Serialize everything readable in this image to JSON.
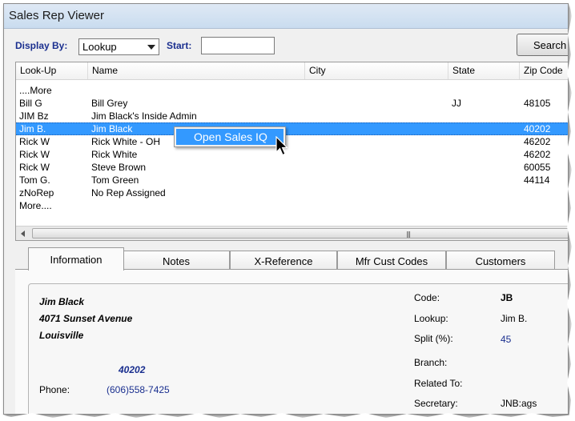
{
  "window": {
    "title": "Sales Rep Viewer"
  },
  "toolbar": {
    "display_by_label": "Display By:",
    "display_by_value": "Lookup",
    "start_label": "Start:",
    "start_value": "",
    "search_label": "Search"
  },
  "grid": {
    "columns": [
      "Look-Up",
      "Name",
      "City",
      "State",
      "Zip Code"
    ],
    "rows": [
      {
        "lookup": "....More",
        "name": "",
        "city": "",
        "state": "",
        "zip": ""
      },
      {
        "lookup": "Bill G",
        "name": "Bill Grey",
        "city": "",
        "state": "JJ",
        "zip": "48105"
      },
      {
        "lookup": "JIM Bz",
        "name": "Jim Black's Inside Admin",
        "city": "",
        "state": "",
        "zip": ""
      },
      {
        "lookup": "Jim B.",
        "name": "Jim Black",
        "city": "",
        "state": "",
        "zip": "40202"
      },
      {
        "lookup": "Rick W",
        "name": "Rick White - OH",
        "city": "",
        "state": "",
        "zip": "46202"
      },
      {
        "lookup": "Rick W",
        "name": "Rick White",
        "city": "",
        "state": "",
        "zip": "46202"
      },
      {
        "lookup": "Rick W",
        "name": "Steve Brown",
        "city": "",
        "state": "",
        "zip": "60055"
      },
      {
        "lookup": "Tom G.",
        "name": "Tom Green",
        "city": "",
        "state": "",
        "zip": "44114"
      },
      {
        "lookup": "zNoRep",
        "name": "No Rep Assigned",
        "city": "",
        "state": "",
        "zip": ""
      },
      {
        "lookup": "More....",
        "name": "",
        "city": "",
        "state": "",
        "zip": ""
      }
    ],
    "selected_row_index": 3
  },
  "context_menu": {
    "item": "Open Sales IQ"
  },
  "tabs": [
    "Information",
    "Notes",
    "X-Reference",
    "Mfr Cust Codes",
    "Customers"
  ],
  "active_tab": "Information",
  "info": {
    "name": "Jim Black",
    "address": "4071 Sunset Avenue",
    "city": "Louisville",
    "zip": "40202",
    "phone_label": "Phone:",
    "phone": "(606)558-7425",
    "code_label": "Code:",
    "code": "JB",
    "lookup_label": "Lookup:",
    "lookup": "Jim B.",
    "split_label": "Split (%):",
    "split": "45",
    "branch_label": "Branch:",
    "related_label": "Related To:",
    "secretary_label": "Secretary:",
    "secretary": "JNB:ags"
  },
  "colors": {
    "selection": "#3399ff",
    "label_blue": "#1a2f8f"
  }
}
